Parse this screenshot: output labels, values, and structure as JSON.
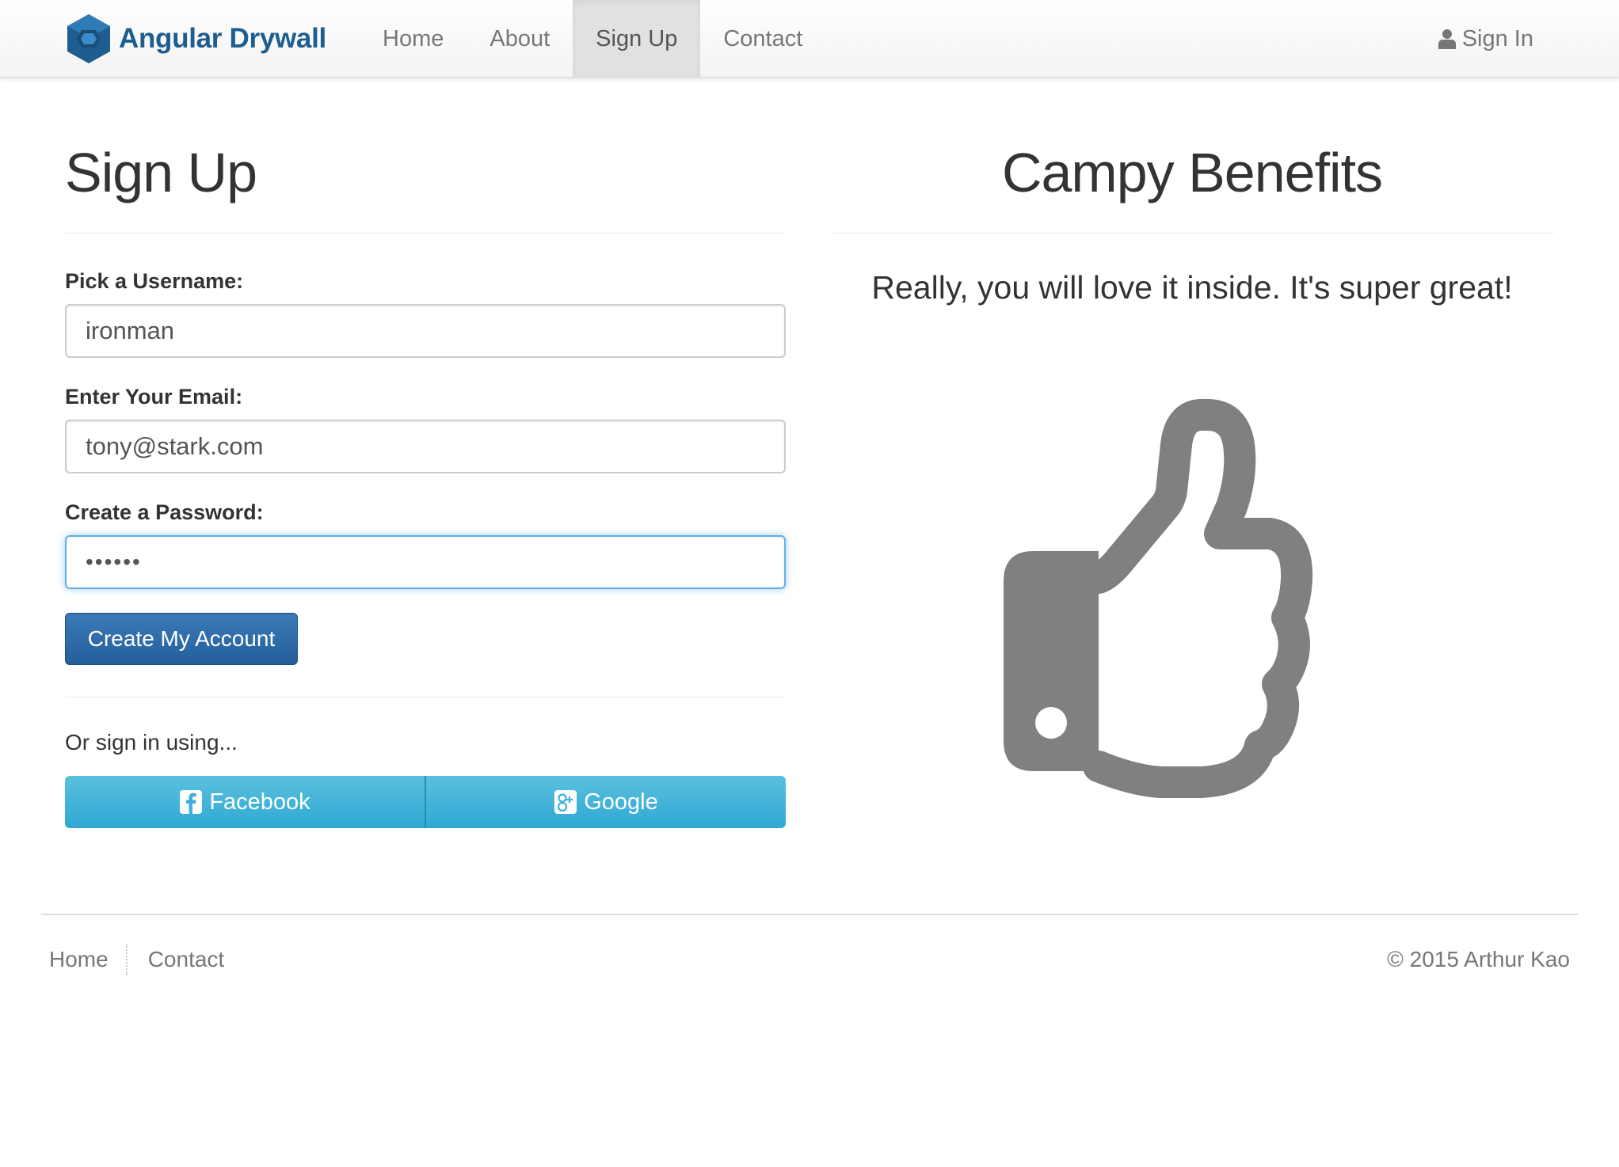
{
  "navbar": {
    "brand": "Angular Drywall",
    "links": [
      "Home",
      "About",
      "Sign Up",
      "Contact"
    ],
    "active_link": "Sign Up",
    "sign_in": "Sign In",
    "brand_color": "#1d5d8f"
  },
  "signup": {
    "title": "Sign Up",
    "username_label": "Pick a Username:",
    "username_value": "ironman",
    "email_label": "Enter Your Email:",
    "email_value": "tony@stark.com",
    "password_label": "Create a Password:",
    "password_value": "••••••",
    "submit_label": "Create My Account",
    "or_text": "Or sign in using...",
    "facebook_label": "Facebook",
    "google_label": "Google"
  },
  "benefits": {
    "title": "Campy Benefits",
    "text": "Really, you will love it inside. It's super great!",
    "icon": "thumbs-up-icon"
  },
  "footer": {
    "links": [
      "Home",
      "Contact"
    ],
    "copyright": "© 2015 Arthur Kao"
  },
  "colors": {
    "primary_button": "#2d6ca8",
    "social_button": "#42b4dc",
    "focus_ring": "#66afe9",
    "icon_gray": "#808080"
  }
}
